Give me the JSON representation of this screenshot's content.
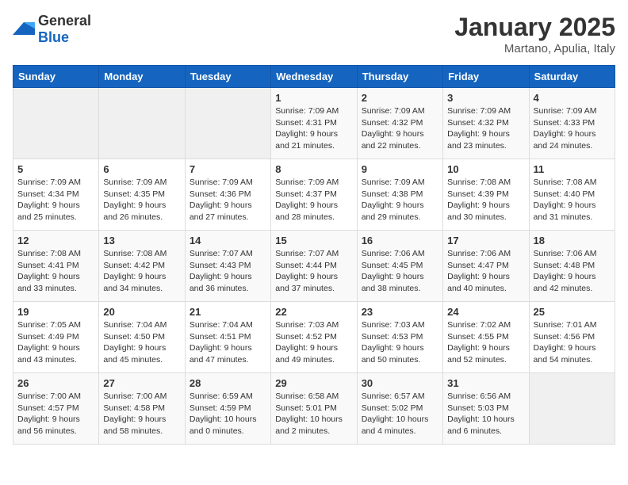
{
  "header": {
    "logo": {
      "general": "General",
      "blue": "Blue"
    },
    "title": "January 2025",
    "subtitle": "Martano, Apulia, Italy"
  },
  "days_of_week": [
    "Sunday",
    "Monday",
    "Tuesday",
    "Wednesday",
    "Thursday",
    "Friday",
    "Saturday"
  ],
  "weeks": [
    [
      {
        "day": "",
        "info": ""
      },
      {
        "day": "",
        "info": ""
      },
      {
        "day": "",
        "info": ""
      },
      {
        "day": "1",
        "info": "Sunrise: 7:09 AM\nSunset: 4:31 PM\nDaylight: 9 hours and 21 minutes."
      },
      {
        "day": "2",
        "info": "Sunrise: 7:09 AM\nSunset: 4:32 PM\nDaylight: 9 hours and 22 minutes."
      },
      {
        "day": "3",
        "info": "Sunrise: 7:09 AM\nSunset: 4:32 PM\nDaylight: 9 hours and 23 minutes."
      },
      {
        "day": "4",
        "info": "Sunrise: 7:09 AM\nSunset: 4:33 PM\nDaylight: 9 hours and 24 minutes."
      }
    ],
    [
      {
        "day": "5",
        "info": "Sunrise: 7:09 AM\nSunset: 4:34 PM\nDaylight: 9 hours and 25 minutes."
      },
      {
        "day": "6",
        "info": "Sunrise: 7:09 AM\nSunset: 4:35 PM\nDaylight: 9 hours and 26 minutes."
      },
      {
        "day": "7",
        "info": "Sunrise: 7:09 AM\nSunset: 4:36 PM\nDaylight: 9 hours and 27 minutes."
      },
      {
        "day": "8",
        "info": "Sunrise: 7:09 AM\nSunset: 4:37 PM\nDaylight: 9 hours and 28 minutes."
      },
      {
        "day": "9",
        "info": "Sunrise: 7:09 AM\nSunset: 4:38 PM\nDaylight: 9 hours and 29 minutes."
      },
      {
        "day": "10",
        "info": "Sunrise: 7:08 AM\nSunset: 4:39 PM\nDaylight: 9 hours and 30 minutes."
      },
      {
        "day": "11",
        "info": "Sunrise: 7:08 AM\nSunset: 4:40 PM\nDaylight: 9 hours and 31 minutes."
      }
    ],
    [
      {
        "day": "12",
        "info": "Sunrise: 7:08 AM\nSunset: 4:41 PM\nDaylight: 9 hours and 33 minutes."
      },
      {
        "day": "13",
        "info": "Sunrise: 7:08 AM\nSunset: 4:42 PM\nDaylight: 9 hours and 34 minutes."
      },
      {
        "day": "14",
        "info": "Sunrise: 7:07 AM\nSunset: 4:43 PM\nDaylight: 9 hours and 36 minutes."
      },
      {
        "day": "15",
        "info": "Sunrise: 7:07 AM\nSunset: 4:44 PM\nDaylight: 9 hours and 37 minutes."
      },
      {
        "day": "16",
        "info": "Sunrise: 7:06 AM\nSunset: 4:45 PM\nDaylight: 9 hours and 38 minutes."
      },
      {
        "day": "17",
        "info": "Sunrise: 7:06 AM\nSunset: 4:47 PM\nDaylight: 9 hours and 40 minutes."
      },
      {
        "day": "18",
        "info": "Sunrise: 7:06 AM\nSunset: 4:48 PM\nDaylight: 9 hours and 42 minutes."
      }
    ],
    [
      {
        "day": "19",
        "info": "Sunrise: 7:05 AM\nSunset: 4:49 PM\nDaylight: 9 hours and 43 minutes."
      },
      {
        "day": "20",
        "info": "Sunrise: 7:04 AM\nSunset: 4:50 PM\nDaylight: 9 hours and 45 minutes."
      },
      {
        "day": "21",
        "info": "Sunrise: 7:04 AM\nSunset: 4:51 PM\nDaylight: 9 hours and 47 minutes."
      },
      {
        "day": "22",
        "info": "Sunrise: 7:03 AM\nSunset: 4:52 PM\nDaylight: 9 hours and 49 minutes."
      },
      {
        "day": "23",
        "info": "Sunrise: 7:03 AM\nSunset: 4:53 PM\nDaylight: 9 hours and 50 minutes."
      },
      {
        "day": "24",
        "info": "Sunrise: 7:02 AM\nSunset: 4:55 PM\nDaylight: 9 hours and 52 minutes."
      },
      {
        "day": "25",
        "info": "Sunrise: 7:01 AM\nSunset: 4:56 PM\nDaylight: 9 hours and 54 minutes."
      }
    ],
    [
      {
        "day": "26",
        "info": "Sunrise: 7:00 AM\nSunset: 4:57 PM\nDaylight: 9 hours and 56 minutes."
      },
      {
        "day": "27",
        "info": "Sunrise: 7:00 AM\nSunset: 4:58 PM\nDaylight: 9 hours and 58 minutes."
      },
      {
        "day": "28",
        "info": "Sunrise: 6:59 AM\nSunset: 4:59 PM\nDaylight: 10 hours and 0 minutes."
      },
      {
        "day": "29",
        "info": "Sunrise: 6:58 AM\nSunset: 5:01 PM\nDaylight: 10 hours and 2 minutes."
      },
      {
        "day": "30",
        "info": "Sunrise: 6:57 AM\nSunset: 5:02 PM\nDaylight: 10 hours and 4 minutes."
      },
      {
        "day": "31",
        "info": "Sunrise: 6:56 AM\nSunset: 5:03 PM\nDaylight: 10 hours and 6 minutes."
      },
      {
        "day": "",
        "info": ""
      }
    ]
  ]
}
